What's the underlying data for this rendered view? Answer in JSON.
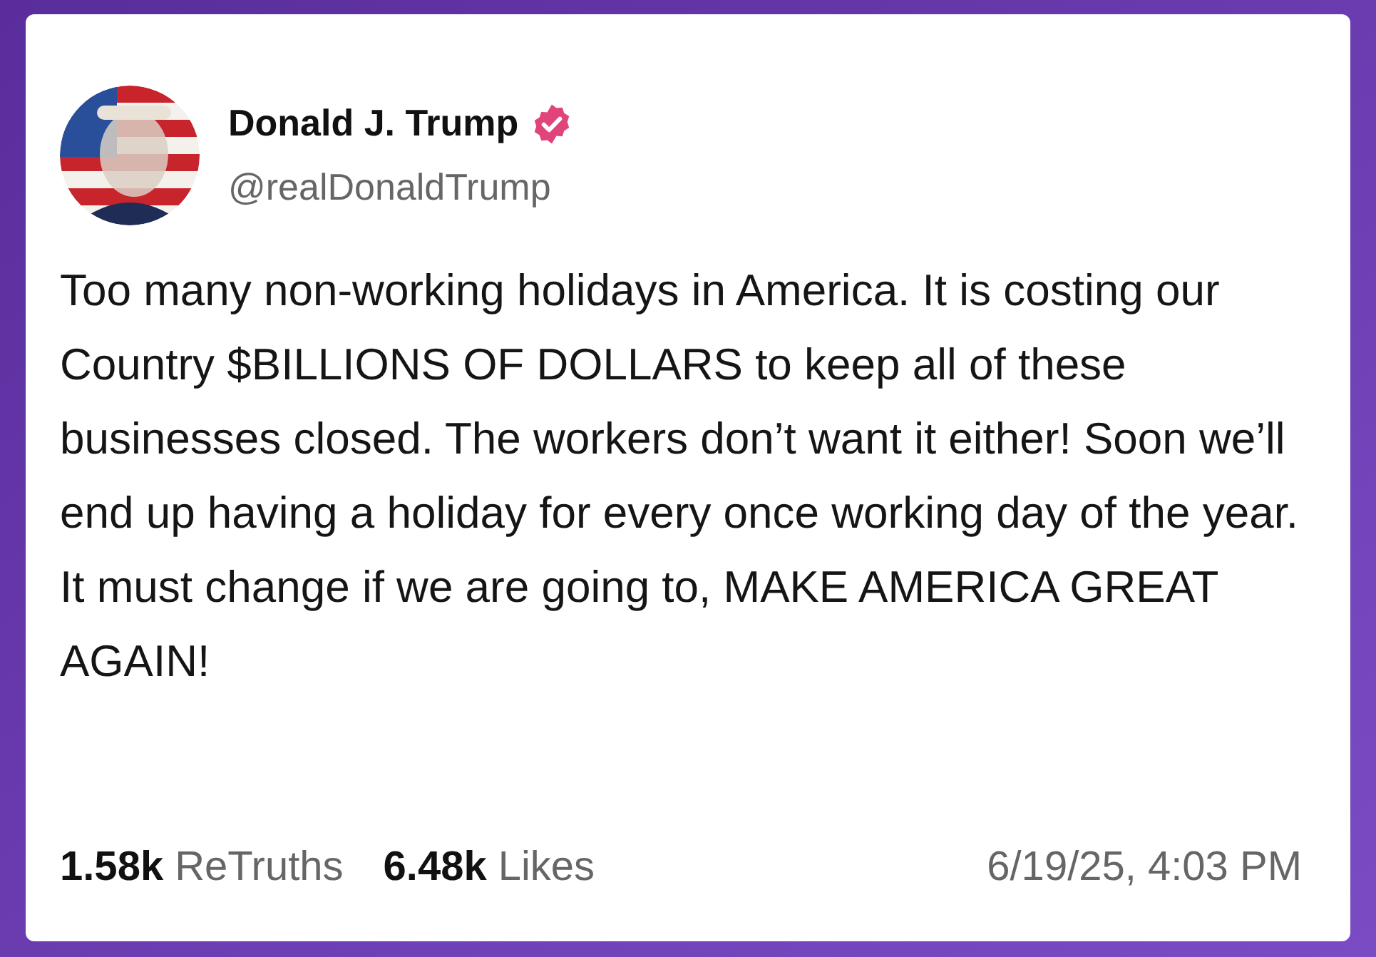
{
  "post": {
    "author": "Donald J. Trump",
    "verified": true,
    "handle": "@realDonaldTrump",
    "text": "Too many non-working holidays in America. It is costing our Country $BILLIONS OF DOLLARS to keep all of these businesses closed. The workers don’t want it either! Soon we’ll end up having a holiday for every once working day of the year. It must change if we are going to, MAKE AMERICA GREAT AGAIN!",
    "stats": [
      {
        "count": "1.58k",
        "label": "ReTruths"
      },
      {
        "count": "6.48k",
        "label": "Likes"
      }
    ],
    "timestamp": "6/19/25, 4:03 PM"
  }
}
